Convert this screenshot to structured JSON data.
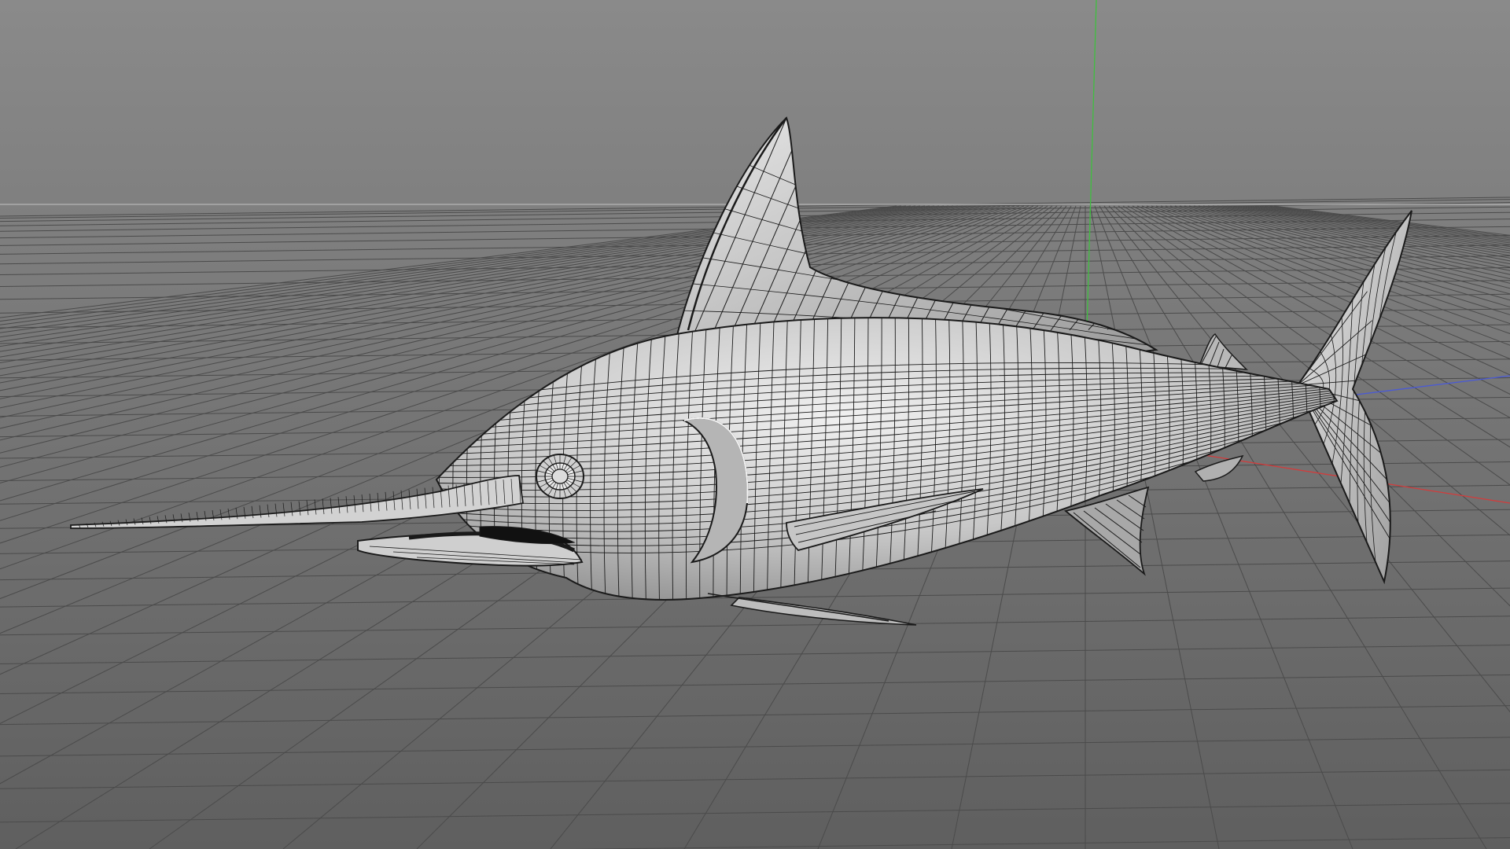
{
  "viewport": {
    "view": "perspective",
    "display_mode": "wireframe",
    "background_top_color": "#8a8a8a",
    "background_bottom_color": "#5f5f5f",
    "grid_line_color": "#4b4b4b",
    "horizon_line_color": "#b5b5b5"
  },
  "axes": {
    "x_axis_color": "#d23c3c",
    "y_axis_color": "#3fbf3f",
    "z_axis_color": "#4a5ad6"
  },
  "model": {
    "subject": "marlin-fish-mesh",
    "surface_color": "#dcdcdc",
    "shadow_color": "#8e8e8e",
    "wire_color": "#1a1a1a"
  }
}
